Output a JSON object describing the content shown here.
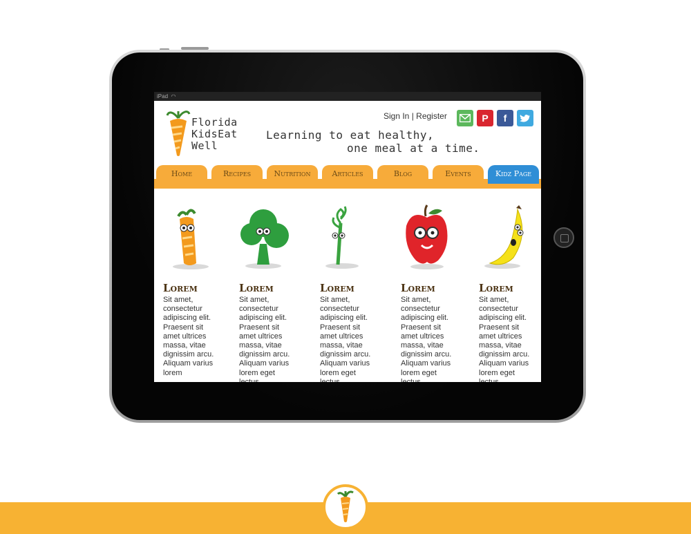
{
  "status_bar": {
    "device": "iPad"
  },
  "logo": {
    "lines": [
      "Florida",
      "KidsEat",
      "Well"
    ]
  },
  "tagline": {
    "line1": "Learning to eat healthy,",
    "line2": "one meal at a time."
  },
  "account": {
    "signin": "Sign In",
    "separator": " | ",
    "register": "Register"
  },
  "social": [
    {
      "name": "email",
      "icon": "envelope-icon",
      "color": "#5cb85c"
    },
    {
      "name": "pinterest",
      "icon": "pinterest-icon",
      "glyph": "P",
      "color": "#d9262f"
    },
    {
      "name": "facebook",
      "icon": "facebook-icon",
      "glyph": "f",
      "color": "#3b5998"
    },
    {
      "name": "twitter",
      "icon": "twitter-icon",
      "color": "#3fa9e0"
    }
  ],
  "nav": {
    "items": [
      "Home",
      "Recipes",
      "Nutrition",
      "Articles",
      "Blog",
      "Events",
      "Kidz Page"
    ],
    "active": "Kidz Page",
    "color": "#f7ab3a",
    "active_color": "#2f8ed6"
  },
  "characters": [
    {
      "icon": "carrot-character-icon",
      "title": "Lorem",
      "body": "Sit amet, consectetur adipiscing elit. Praesent sit amet ultrices massa, vitae dignissim arcu. Aliquam varius lorem"
    },
    {
      "icon": "broccoli-character-icon",
      "title": "Lorem",
      "body": "Sit amet, consectetur adipiscing elit. Praesent sit amet ultrices massa, vitae dignissim arcu. Aliquam varius lorem eget lectus"
    },
    {
      "icon": "asparagus-character-icon",
      "title": "Lorem",
      "body": "Sit amet, consectetur adipiscing elit. Praesent sit amet ultrices massa, vitae dignissim arcu. Aliquam varius lorem eget lectus"
    },
    {
      "icon": "apple-character-icon",
      "title": "Lorem",
      "body": "Sit amet, consectetur adipiscing elit. Praesent sit amet ultrices massa, vitae dignissim arcu. Aliquam varius lorem eget lectus"
    },
    {
      "icon": "banana-character-icon",
      "title": "Lorem",
      "body": "Sit amet, consectetur adipiscing elit. Praesent sit amet ultrices massa, vitae dignissim arcu. Aliquam varius lorem eget lectus"
    }
  ],
  "brand_color": "#f7b233"
}
